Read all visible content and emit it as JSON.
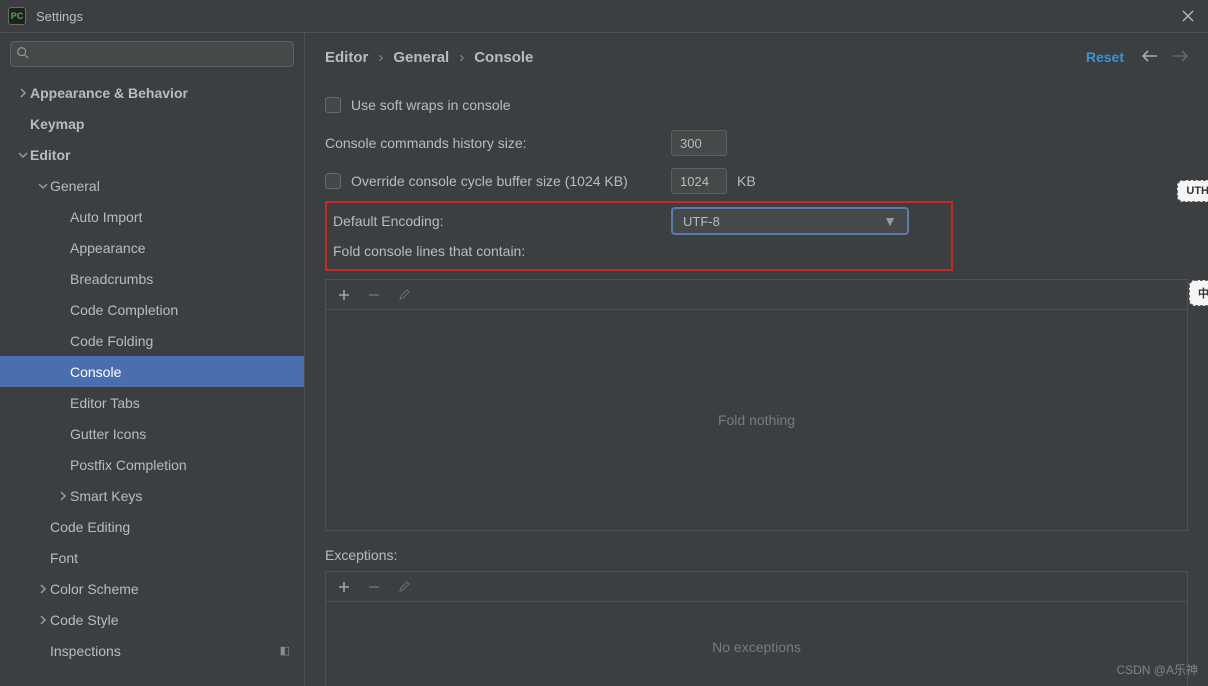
{
  "window": {
    "title": "Settings"
  },
  "search": {
    "placeholder": ""
  },
  "sidebar": {
    "items": [
      {
        "label": "Appearance & Behavior",
        "level": 0,
        "expanded": false,
        "hasChildren": true,
        "bold": true
      },
      {
        "label": "Keymap",
        "level": 0,
        "hasChildren": false,
        "bold": true
      },
      {
        "label": "Editor",
        "level": 0,
        "expanded": true,
        "hasChildren": true,
        "bold": true
      },
      {
        "label": "General",
        "level": 1,
        "expanded": true,
        "hasChildren": true
      },
      {
        "label": "Auto Import",
        "level": 2
      },
      {
        "label": "Appearance",
        "level": 2
      },
      {
        "label": "Breadcrumbs",
        "level": 2
      },
      {
        "label": "Code Completion",
        "level": 2
      },
      {
        "label": "Code Folding",
        "level": 2
      },
      {
        "label": "Console",
        "level": 2,
        "selected": true
      },
      {
        "label": "Editor Tabs",
        "level": 2
      },
      {
        "label": "Gutter Icons",
        "level": 2
      },
      {
        "label": "Postfix Completion",
        "level": 2
      },
      {
        "label": "Smart Keys",
        "level": 2,
        "expanded": false,
        "hasChildren": true
      },
      {
        "label": "Code Editing",
        "level": 1
      },
      {
        "label": "Font",
        "level": 1
      },
      {
        "label": "Color Scheme",
        "level": 1,
        "expanded": false,
        "hasChildren": true
      },
      {
        "label": "Code Style",
        "level": 1,
        "expanded": false,
        "hasChildren": true
      },
      {
        "label": "Inspections",
        "level": 1,
        "separateWindow": true
      }
    ]
  },
  "breadcrumb": [
    "Editor",
    "General",
    "Console"
  ],
  "header": {
    "reset": "Reset"
  },
  "form": {
    "soft_wraps_label": "Use soft wraps in console",
    "history_label": "Console commands history size:",
    "history_value": "300",
    "override_label": "Override console cycle buffer size (1024 KB)",
    "override_value": "1024",
    "override_unit": "KB",
    "encoding_label": "Default Encoding:",
    "encoding_value": "UTF-8",
    "fold_label": "Fold console lines that contain:",
    "fold_empty": "Fold nothing",
    "exceptions_label": "Exceptions:",
    "exceptions_empty": "No exceptions"
  },
  "watermark": "CSDN @A乐神",
  "edge_badges": [
    "UTH",
    "中"
  ]
}
